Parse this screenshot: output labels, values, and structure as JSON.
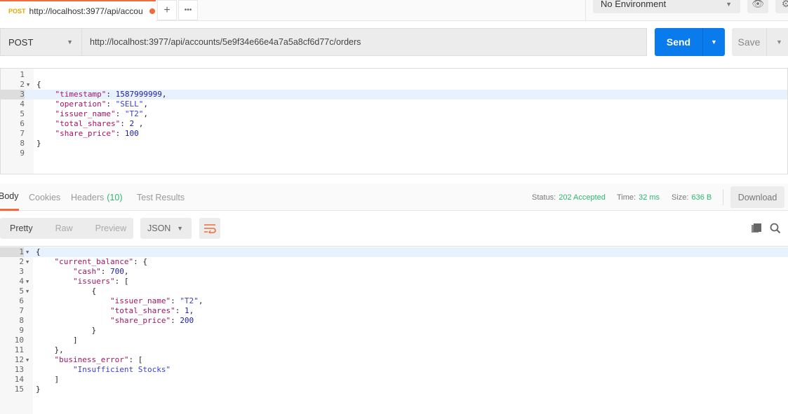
{
  "tab": {
    "method": "POST",
    "title": "http://localhost:3977/api/accou",
    "unsaved": true,
    "add": "+",
    "more": "•••"
  },
  "environment": {
    "selected": "No Environment"
  },
  "request": {
    "method": "POST",
    "url": "http://localhost:3977/api/accounts/5e9f34e66e4a7a5a8cf6d77c/orders",
    "send": "Send",
    "save": "Save",
    "body": [
      [],
      [
        [
          "p",
          "{"
        ]
      ],
      [
        [
          "p",
          "    "
        ],
        [
          "k",
          "\"timestamp\""
        ],
        [
          "p",
          ": "
        ],
        [
          "n",
          "1587999999"
        ],
        [
          "p",
          ","
        ]
      ],
      [
        [
          "p",
          "    "
        ],
        [
          "k",
          "\"operation\""
        ],
        [
          "p",
          ": "
        ],
        [
          "s",
          "\"SELL\""
        ],
        [
          "p",
          ","
        ]
      ],
      [
        [
          "p",
          "    "
        ],
        [
          "k",
          "\"issuer_name\""
        ],
        [
          "p",
          ": "
        ],
        [
          "s",
          "\"T2\""
        ],
        [
          "p",
          ","
        ]
      ],
      [
        [
          "p",
          "    "
        ],
        [
          "k",
          "\"total_shares\""
        ],
        [
          "p",
          ": "
        ],
        [
          "n",
          "2"
        ],
        [
          "p",
          " ,"
        ]
      ],
      [
        [
          "p",
          "    "
        ],
        [
          "k",
          "\"share_price\""
        ],
        [
          "p",
          ": "
        ],
        [
          "n",
          "100"
        ]
      ],
      [
        [
          "p",
          "}"
        ]
      ],
      []
    ],
    "folds": [
      2
    ],
    "active_line": 3
  },
  "response": {
    "tabs": [
      {
        "label": "Body",
        "active": true
      },
      {
        "label": "Cookies"
      },
      {
        "label": "Headers",
        "count": "(10)"
      },
      {
        "label": "Test Results"
      }
    ],
    "status_label": "Status:",
    "status": "202 Accepted",
    "time_label": "Time:",
    "time": "32 ms",
    "size_label": "Size:",
    "size": "636 B",
    "download": "Download",
    "views": [
      "Pretty",
      "Raw",
      "Preview"
    ],
    "active_view": "Pretty",
    "format": "JSON",
    "body": [
      [
        [
          "p",
          "{"
        ]
      ],
      [
        [
          "p",
          "    "
        ],
        [
          "k",
          "\"current_balance\""
        ],
        [
          "p",
          ": {"
        ]
      ],
      [
        [
          "p",
          "        "
        ],
        [
          "k",
          "\"cash\""
        ],
        [
          "p",
          ": "
        ],
        [
          "n",
          "700"
        ],
        [
          "p",
          ","
        ]
      ],
      [
        [
          "p",
          "        "
        ],
        [
          "k",
          "\"issuers\""
        ],
        [
          "p",
          ": ["
        ]
      ],
      [
        [
          "p",
          "            {"
        ]
      ],
      [
        [
          "p",
          "                "
        ],
        [
          "k",
          "\"issuer_name\""
        ],
        [
          "p",
          ": "
        ],
        [
          "s",
          "\"T2\""
        ],
        [
          "p",
          ","
        ]
      ],
      [
        [
          "p",
          "                "
        ],
        [
          "k",
          "\"total_shares\""
        ],
        [
          "p",
          ": "
        ],
        [
          "n",
          "1"
        ],
        [
          "p",
          ","
        ]
      ],
      [
        [
          "p",
          "                "
        ],
        [
          "k",
          "\"share_price\""
        ],
        [
          "p",
          ": "
        ],
        [
          "n",
          "200"
        ]
      ],
      [
        [
          "p",
          "            }"
        ]
      ],
      [
        [
          "p",
          "        ]"
        ]
      ],
      [
        [
          "p",
          "    },"
        ]
      ],
      [
        [
          "p",
          "    "
        ],
        [
          "k",
          "\"business_error\""
        ],
        [
          "p",
          ": ["
        ]
      ],
      [
        [
          "p",
          "        "
        ],
        [
          "s",
          "\"Insufficient Stocks\""
        ]
      ],
      [
        [
          "p",
          "    ]"
        ]
      ],
      [
        [
          "p",
          "}"
        ]
      ]
    ],
    "folds": [
      1,
      2,
      4,
      5,
      12
    ],
    "active_line": 1
  },
  "colors": {
    "accent": "#f26b3a",
    "send": "#097bed",
    "success": "#2bb673"
  }
}
